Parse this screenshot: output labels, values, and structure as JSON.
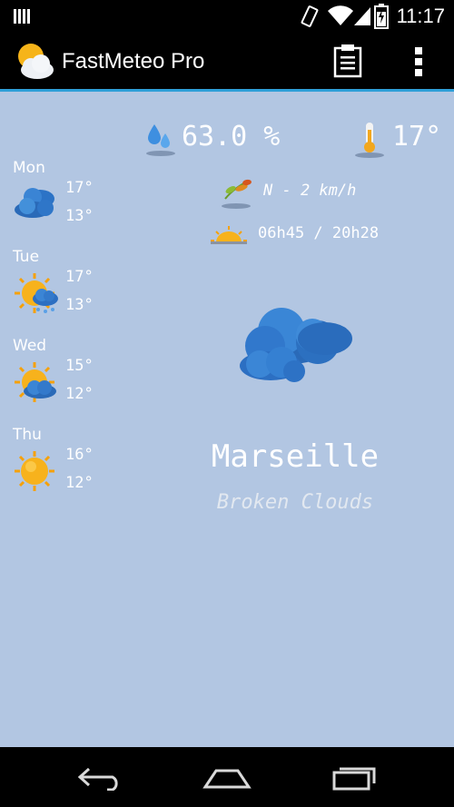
{
  "status_bar": {
    "time": "11:17",
    "icons": [
      "notification-icon",
      "vibrate-icon",
      "wifi-icon",
      "signal-icon",
      "battery-icon"
    ]
  },
  "app_bar": {
    "title": "FastMeteo Pro",
    "icons": [
      "app-weather-icon",
      "clipboard-icon",
      "overflow-menu-icon"
    ]
  },
  "current": {
    "humidity": "63.0 %",
    "temperature": "17°",
    "wind": "N - 2 km/h",
    "sun_times": "06h45 / 20h28",
    "city": "Marseille",
    "condition": "Broken Clouds",
    "condition_icon": "broken-clouds-icon"
  },
  "forecast": [
    {
      "day": "Mon",
      "high": "17°",
      "low": "13°",
      "icon": "cloudy-icon"
    },
    {
      "day": "Tue",
      "high": "17°",
      "low": "13°",
      "icon": "sun-cloud-rain-icon"
    },
    {
      "day": "Wed",
      "high": "15°",
      "low": "12°",
      "icon": "sun-cloud-icon"
    },
    {
      "day": "Thu",
      "high": "16°",
      "low": "12°",
      "icon": "sun-icon"
    }
  ],
  "nav_bar": {
    "icons": [
      "back-icon",
      "home-icon",
      "recents-icon"
    ]
  },
  "colors": {
    "background": "#b2c6e2",
    "accent": "#2e9fd8",
    "bars": "#000000"
  }
}
